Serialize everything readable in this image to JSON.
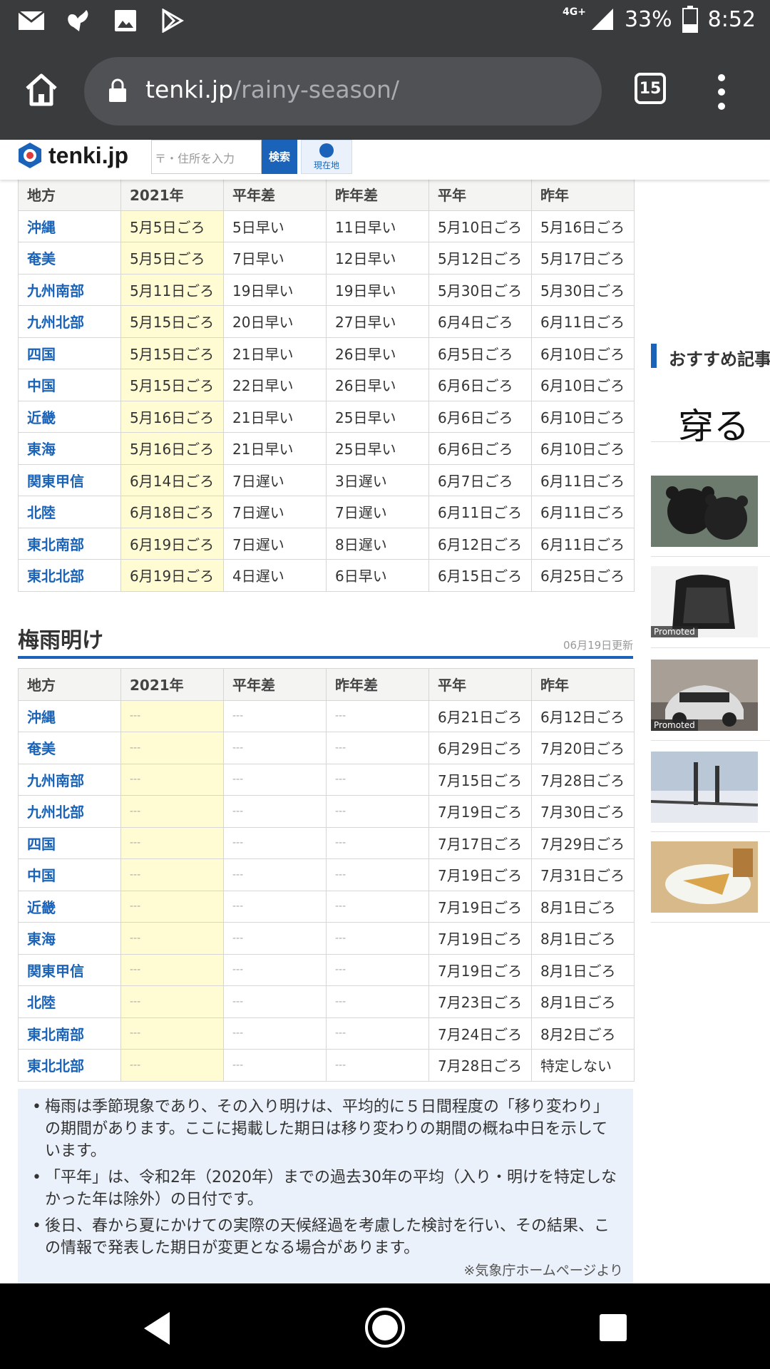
{
  "status_bar": {
    "network": "4G+",
    "battery": "33%",
    "time": "8:52",
    "left_icons": [
      "mail-icon",
      "app-icon",
      "image-icon",
      "play-store-icon"
    ]
  },
  "browser": {
    "url_host": "tenki.jp",
    "url_path": "/rainy-season/",
    "tab_count": "15"
  },
  "site_header": {
    "logo": "tenki.jp",
    "search_placeholder": "〒・住所を入力",
    "search_button": "検索",
    "location_button": "現在地"
  },
  "onset_table": {
    "headers": [
      "地方",
      "2021年",
      "平年差",
      "昨年差",
      "平年",
      "昨年"
    ],
    "rows": [
      [
        "沖縄",
        "5月5日ごろ",
        "5日早い",
        "11日早い",
        "5月10日ごろ",
        "5月16日ごろ"
      ],
      [
        "奄美",
        "5月5日ごろ",
        "7日早い",
        "12日早い",
        "5月12日ごろ",
        "5月17日ごろ"
      ],
      [
        "九州南部",
        "5月11日ごろ",
        "19日早い",
        "19日早い",
        "5月30日ごろ",
        "5月30日ごろ"
      ],
      [
        "九州北部",
        "5月15日ごろ",
        "20日早い",
        "27日早い",
        "6月4日ごろ",
        "6月11日ごろ"
      ],
      [
        "四国",
        "5月15日ごろ",
        "21日早い",
        "26日早い",
        "6月5日ごろ",
        "6月10日ごろ"
      ],
      [
        "中国",
        "5月15日ごろ",
        "22日早い",
        "26日早い",
        "6月6日ごろ",
        "6月10日ごろ"
      ],
      [
        "近畿",
        "5月16日ごろ",
        "21日早い",
        "25日早い",
        "6月6日ごろ",
        "6月10日ごろ"
      ],
      [
        "東海",
        "5月16日ごろ",
        "21日早い",
        "25日早い",
        "6月6日ごろ",
        "6月10日ごろ"
      ],
      [
        "関東甲信",
        "6月14日ごろ",
        "7日遅い",
        "3日遅い",
        "6月7日ごろ",
        "6月11日ごろ"
      ],
      [
        "北陸",
        "6月18日ごろ",
        "7日遅い",
        "7日遅い",
        "6月11日ごろ",
        "6月11日ごろ"
      ],
      [
        "東北南部",
        "6月19日ごろ",
        "7日遅い",
        "8日遅い",
        "6月12日ごろ",
        "6月11日ごろ"
      ],
      [
        "東北北部",
        "6月19日ごろ",
        "4日遅い",
        "6日早い",
        "6月15日ごろ",
        "6月25日ごろ"
      ]
    ]
  },
  "end_section": {
    "title": "梅雨明け",
    "updated": "06月19日更新"
  },
  "end_table": {
    "headers": [
      "地方",
      "2021年",
      "平年差",
      "昨年差",
      "平年",
      "昨年"
    ],
    "rows": [
      [
        "沖縄",
        "---",
        "---",
        "---",
        "6月21日ごろ",
        "6月12日ごろ"
      ],
      [
        "奄美",
        "---",
        "---",
        "---",
        "6月29日ごろ",
        "7月20日ごろ"
      ],
      [
        "九州南部",
        "---",
        "---",
        "---",
        "7月15日ごろ",
        "7月28日ごろ"
      ],
      [
        "九州北部",
        "---",
        "---",
        "---",
        "7月19日ごろ",
        "7月30日ごろ"
      ],
      [
        "四国",
        "---",
        "---",
        "---",
        "7月17日ごろ",
        "7月29日ごろ"
      ],
      [
        "中国",
        "---",
        "---",
        "---",
        "7月19日ごろ",
        "7月31日ごろ"
      ],
      [
        "近畿",
        "---",
        "---",
        "---",
        "7月19日ごろ",
        "8月1日ごろ"
      ],
      [
        "東海",
        "---",
        "---",
        "---",
        "7月19日ごろ",
        "8月1日ごろ"
      ],
      [
        "関東甲信",
        "---",
        "---",
        "---",
        "7月19日ごろ",
        "8月1日ごろ"
      ],
      [
        "北陸",
        "---",
        "---",
        "---",
        "7月23日ごろ",
        "8月1日ごろ"
      ],
      [
        "東北南部",
        "---",
        "---",
        "---",
        "7月24日ごろ",
        "8月2日ごろ"
      ],
      [
        "東北北部",
        "---",
        "---",
        "---",
        "7月28日ごろ",
        "特定しない"
      ]
    ]
  },
  "notes": {
    "items": [
      "梅雨は季節現象であり、その入り明けは、平均的に５日間程度の「移り変わり」の期間があります。ここに掲載した期日は移り変わりの期間の概ね中日を示しています。",
      "「平年」は、令和2年（2020年）までの過去30年の平均（入り・明けを特定しなかった年は除外）の日付です。",
      "後日、春から夏にかけての実際の天候経過を考慮した検討を行い、その結果、この情報で発表した期日が変更となる場合があります。"
    ],
    "source": "※気象庁ホームページより"
  },
  "sidebar": {
    "recommend_title": "おすすめ記事",
    "feature_text": "穿る",
    "promoted_label": "Promoted"
  },
  "colors": {
    "accent": "#1a63b8",
    "highlight": "#fffbd3",
    "chrome": "#3a3b3d"
  }
}
